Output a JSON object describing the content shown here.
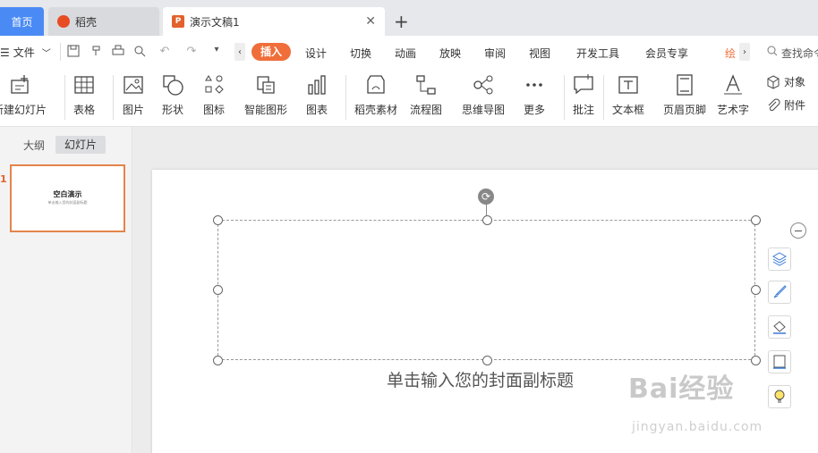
{
  "tabs": {
    "home": "首页",
    "daoke": "稻壳",
    "doc": "演示文稿1",
    "doc_icon": "P"
  },
  "menubar": {
    "file_label": "文件",
    "items": [
      "插入",
      "设计",
      "切换",
      "动画",
      "放映",
      "审阅",
      "视图",
      "开发工具",
      "会员专享",
      "绘"
    ],
    "active": "插入",
    "search_placeholder": "查找命令"
  },
  "ribbon": {
    "new_slide": "新建幻灯片",
    "table": "表格",
    "picture": "图片",
    "shape": "形状",
    "icon": "图标",
    "smart_shape": "智能图形",
    "chart": "图表",
    "daoke_material": "稻壳素材",
    "flowchart": "流程图",
    "mindmap": "思维导图",
    "more": "更多",
    "comment": "批注",
    "textbox": "文本框",
    "header_footer": "页眉页脚",
    "wordart": "艺术字",
    "object": "对象",
    "attachment": "附件"
  },
  "leftpanel": {
    "outline_tab": "大纲",
    "slides_tab": "幻灯片",
    "slide_number": "1",
    "thumb_title": "空白演示",
    "thumb_subtitle": "单击输入您的封面副标题"
  },
  "slide": {
    "subtitle_placeholder": "单击输入您的封面副标题"
  },
  "watermark": {
    "text": "Bai经验",
    "url": "jingyan.baidu.com"
  },
  "colors": {
    "accent": "#f06e3a",
    "home_tab": "#4a8af4",
    "thumb_border": "#e3844a"
  }
}
